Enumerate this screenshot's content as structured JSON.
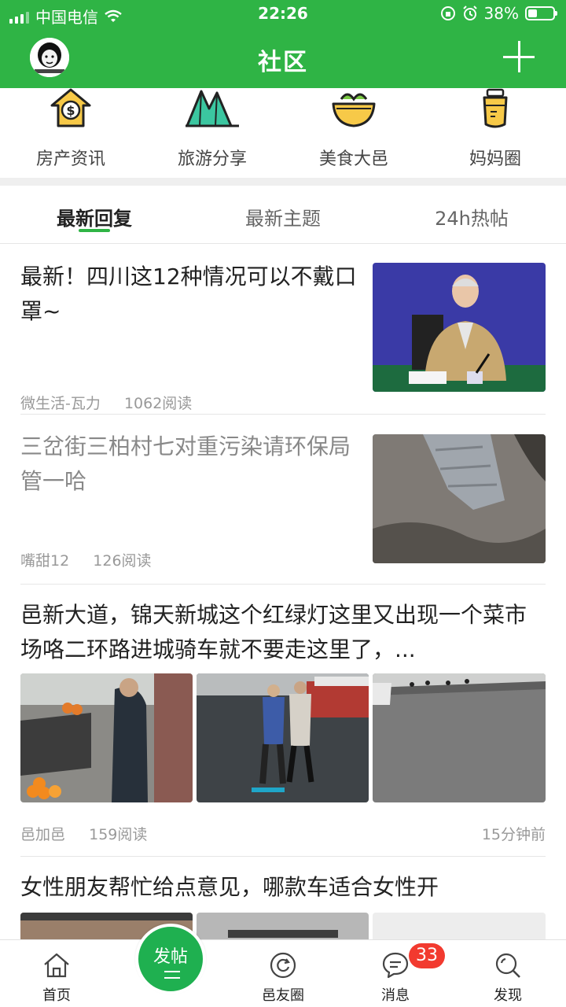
{
  "status": {
    "carrier": "中国电信",
    "time": "22:26",
    "battery_text": "38%",
    "battery_level": 0.38
  },
  "nav": {
    "title": "社区"
  },
  "categories": [
    {
      "label": "房产资讯",
      "icon": "house-coin-icon"
    },
    {
      "label": "旅游分享",
      "icon": "mountain-icon"
    },
    {
      "label": "美食大邑",
      "icon": "noodle-bowl-icon"
    },
    {
      "label": "妈妈圈",
      "icon": "baby-bottle-icon"
    }
  ],
  "tabs": [
    {
      "label": "最新回复",
      "active": true
    },
    {
      "label": "最新主题",
      "active": false
    },
    {
      "label": "24h热帖",
      "active": false
    }
  ],
  "posts": [
    {
      "title": "最新！四川这12种情况可以不戴口罩~",
      "author": "微生活-瓦力",
      "reads": "1062阅读",
      "read_state": "unread"
    },
    {
      "title": "三岔街三柏村七对重污染请环保局管一哈",
      "author": "嘴甜12",
      "reads": "126阅读",
      "read_state": "read"
    },
    {
      "title": "邑新大道，锦天新城这个红绿灯这里又出现一个菜市场咯二环路进城骑车就不要走这里了，...",
      "author": "邑加邑",
      "reads": "159阅读",
      "time": "15分钟前"
    },
    {
      "title": "女性朋友帮忙给点意见，哪款车适合女性开"
    }
  ],
  "bottom_tabs": {
    "home": "首页",
    "post": "发帖",
    "circle": "邑友圈",
    "messages": "消息",
    "discover": "发现",
    "messages_badge": "33"
  },
  "colors": {
    "brand_green": "#2fb445",
    "badge_red": "#f23a2f"
  }
}
